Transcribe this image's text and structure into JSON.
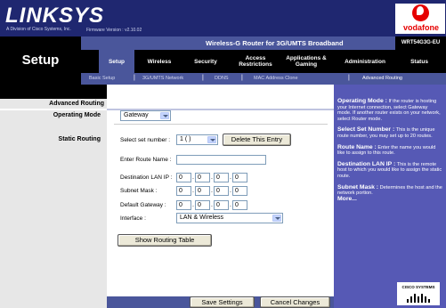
{
  "header": {
    "logo": "LINKSYS",
    "logo_sub": "A Division of Cisco Systems, Inc.",
    "firmware": "Firmware Version : v2.10.02",
    "brand": "vodafone"
  },
  "title_bar": {
    "product_name": "Wireless-G Router for 3G/UMTS Broadband",
    "model": "WRT54G3G-EU"
  },
  "page_title": "Setup",
  "nav": {
    "tabs": [
      {
        "label": "Setup"
      },
      {
        "label": "Wireless"
      },
      {
        "label": "Security"
      },
      {
        "label": "Access Restrictions"
      },
      {
        "label": "Applications & Gaming"
      },
      {
        "label": "Administration"
      },
      {
        "label": "Status"
      }
    ],
    "subtabs": [
      {
        "label": "Basic Setup"
      },
      {
        "label": "3G/UMTS Network"
      },
      {
        "label": "DDNS"
      },
      {
        "label": "MAC Address Clone"
      },
      {
        "label": "Advanced Routing"
      }
    ]
  },
  "section": {
    "title": "Advanced Routing",
    "operating_mode_label": "Operating Mode",
    "static_routing_label": "Static Routing"
  },
  "form": {
    "operating_mode_value": "Gateway",
    "select_set_label": "Select set number :",
    "set_number_value": "1 ( )",
    "delete_button": "Delete This Entry",
    "route_name_label": "Enter Route Name :",
    "route_name_value": "",
    "dest_lan_ip_label": "Destination LAN IP :",
    "dest_lan_ip": [
      "0",
      "0",
      "0",
      "0"
    ],
    "subnet_mask_label": "Subnet Mask :",
    "subnet_mask": [
      "0",
      "0",
      "0",
      "0"
    ],
    "default_gateway_label": "Default Gateway :",
    "default_gateway": [
      "0",
      "0",
      "0",
      "0"
    ],
    "interface_label": "Interface :",
    "interface_value": "LAN & Wireless",
    "show_table_button": "Show Routing Table"
  },
  "help": [
    {
      "head": "Operating Mode :",
      "text": " If the router is hosting your Internet connection, select Gateway mode. If another router exists on your network, select Router mode."
    },
    {
      "head": "Select Set Number :",
      "text": " This is the unique route number, you may set up to 20 routes."
    },
    {
      "head": "Route Name :",
      "text": " Enter the name you would like to assign to this route."
    },
    {
      "head": "Destination LAN IP :",
      "text": " This is the remote host to which you would like to assign the static route."
    },
    {
      "head": "Subnet Mask :",
      "text": " Determines the host and the network portion."
    }
  ],
  "help_more": "More...",
  "cisco": "CISCO SYSTEMS",
  "footer": {
    "save_button": "Save Settings",
    "cancel_button": "Cancel Changes"
  },
  "colors": {
    "header_bg": "#1f2770",
    "accent": "#4a569b",
    "help_bg": "#5659b5"
  }
}
